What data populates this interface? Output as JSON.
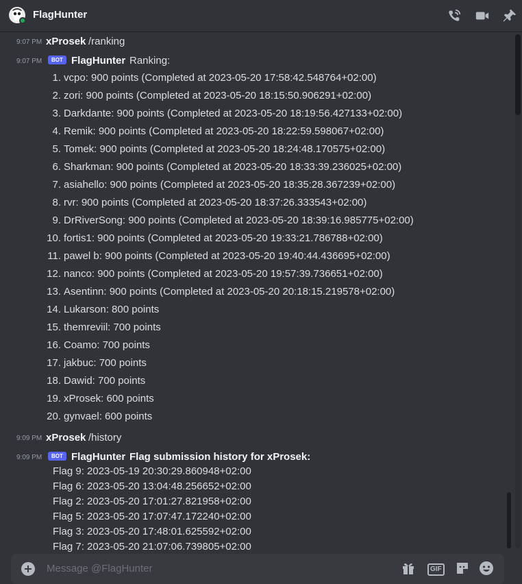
{
  "header": {
    "title": "FlagHunter",
    "icons": [
      "phone-call-icon",
      "video-camera-icon",
      "pin-icon"
    ]
  },
  "colors": {
    "background": "#313338",
    "accent": "#5865f2",
    "online": "#23a55a"
  },
  "messages": [
    {
      "time": "9:07 PM",
      "user": "xProsek",
      "command": "/ranking"
    },
    {
      "time": "9:07 PM",
      "badge": "BOT",
      "user": "FlagHunter",
      "heading": "Ranking:",
      "ranking": [
        {
          "num": "1.",
          "text": "vcpo: 900 points (Completed at 2023-05-20 17:58:42.548764+02:00)"
        },
        {
          "num": "2.",
          "text": "zori: 900 points (Completed at 2023-05-20 18:15:50.906291+02:00)"
        },
        {
          "num": "3.",
          "text": "Darkdante: 900 points (Completed at 2023-05-20 18:19:56.427133+02:00)"
        },
        {
          "num": "4.",
          "text": "Remik: 900 points (Completed at 2023-05-20 18:22:59.598067+02:00)"
        },
        {
          "num": "5.",
          "text": "Tomek: 900 points (Completed at 2023-05-20 18:24:48.170575+02:00)"
        },
        {
          "num": "6.",
          "text": "Sharkman: 900 points (Completed at 2023-05-20 18:33:39.236025+02:00)"
        },
        {
          "num": "7.",
          "text": "asiahello: 900 points (Completed at 2023-05-20 18:35:28.367239+02:00)"
        },
        {
          "num": "8.",
          "text": "rvr: 900 points (Completed at 2023-05-20 18:37:26.333543+02:00)"
        },
        {
          "num": "9.",
          "text": "DrRiverSong: 900 points (Completed at 2023-05-20 18:39:16.985775+02:00)"
        },
        {
          "num": "10.",
          "text": "fortis1: 900 points (Completed at 2023-05-20 19:33:21.786788+02:00)"
        },
        {
          "num": "11.",
          "text": "pawel b: 900 points (Completed at 2023-05-20 19:40:44.436695+02:00)"
        },
        {
          "num": "12.",
          "text": "nanco: 900 points (Completed at 2023-05-20 19:57:39.736651+02:00)"
        },
        {
          "num": "13.",
          "text": "Asentinn: 900 points (Completed at 2023-05-20 20:18:15.219578+02:00)"
        },
        {
          "num": "14.",
          "text": "Lukarson: 800 points"
        },
        {
          "num": "15.",
          "text": "themreviil: 700 points"
        },
        {
          "num": "16.",
          "text": "Coamo: 700 points"
        },
        {
          "num": "17.",
          "text": "jakbuc: 700 points"
        },
        {
          "num": "18.",
          "text": "Dawid: 700 points"
        },
        {
          "num": "19.",
          "text": "xProsek: 600 points"
        },
        {
          "num": "20.",
          "text": "gynvael: 600 points"
        }
      ]
    },
    {
      "time": "9:09 PM",
      "user": "xProsek",
      "command": "/history"
    },
    {
      "time": "9:09 PM",
      "badge": "BOT",
      "user": "FlagHunter",
      "heading": "Flag submission history for xProsek:",
      "history": [
        "Flag 9: 2023-05-19 20:30:29.860948+02:00",
        "Flag 6: 2023-05-20 13:04:48.256652+02:00",
        "Flag 2: 2023-05-20 17:01:27.821958+02:00",
        "Flag 5: 2023-05-20 17:07:47.172240+02:00",
        "Flag 3: 2023-05-20 17:48:01.625592+02:00",
        "Flag 7: 2023-05-20 21:07:06.739805+02:00"
      ]
    }
  ],
  "composer": {
    "placeholder": "Message @FlagHunter",
    "gif_label": "GIF",
    "icons": [
      "add-icon",
      "gift-icon",
      "sticker-icon",
      "emoji-icon"
    ]
  }
}
